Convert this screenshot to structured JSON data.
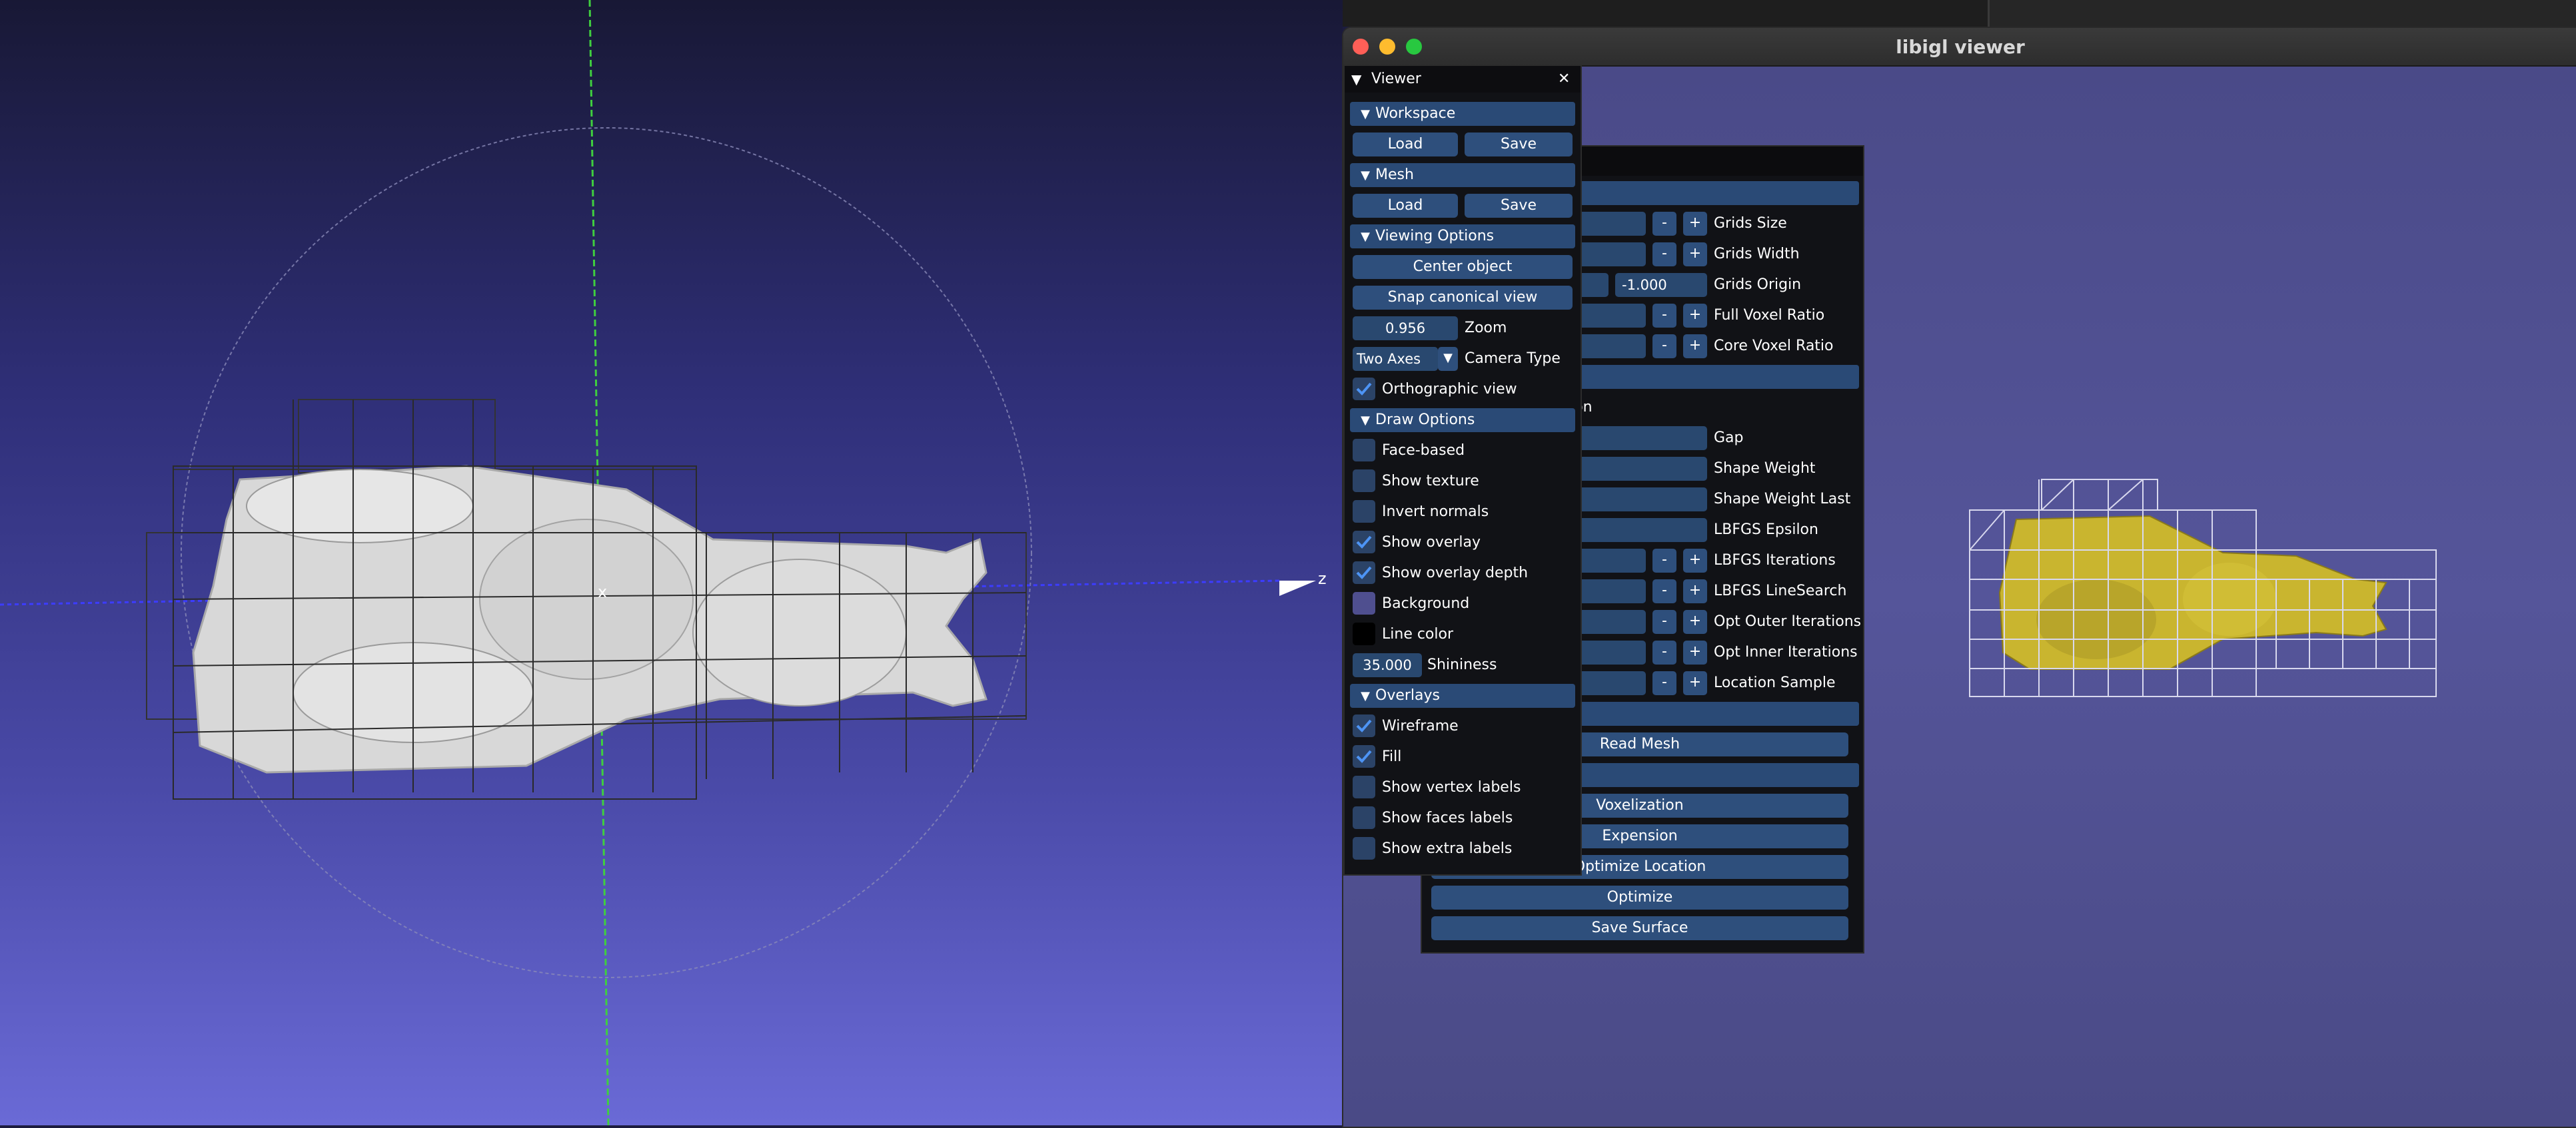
{
  "left_view": {
    "axis_x": "x",
    "axis_z": "z"
  },
  "window": {
    "title": "libigl viewer",
    "colors": {
      "close": "#ff5f57",
      "minimize": "#febc2e",
      "zoom": "#28c840"
    }
  },
  "viewer_panel": {
    "title": "Viewer",
    "close_glyph": "✕",
    "workspace": {
      "header": "Workspace",
      "load": "Load",
      "save": "Save"
    },
    "mesh": {
      "header": "Mesh",
      "load": "Load",
      "save": "Save"
    },
    "viewing_options": {
      "header": "Viewing Options",
      "center_object": "Center object",
      "snap_canonical": "Snap canonical view",
      "zoom_value": "0.956",
      "zoom_label": "Zoom",
      "camera_value": "Two Axes",
      "camera_label": "Camera Type",
      "orthographic_label": "Orthographic view",
      "orthographic_checked": true
    },
    "draw_options": {
      "header": "Draw Options",
      "items": [
        {
          "label": "Face-based",
          "checked": false
        },
        {
          "label": "Show texture",
          "checked": false
        },
        {
          "label": "Invert normals",
          "checked": false
        },
        {
          "label": "Show overlay",
          "checked": true
        },
        {
          "label": "Show overlay depth",
          "checked": true
        }
      ],
      "background_label": "Background",
      "line_color_label": "Line color",
      "shininess_value": "35.000",
      "shininess_label": "Shininess",
      "background_swatch": "#4f4f8f",
      "line_swatch": "#000000"
    },
    "overlays": {
      "header": "Overlays",
      "items": [
        {
          "label": "Wireframe",
          "checked": true
        },
        {
          "label": "Fill",
          "checked": true
        },
        {
          "label": "Show vertex labels",
          "checked": false
        },
        {
          "label": "Show faces labels",
          "checked": false
        },
        {
          "label": "Show extra labels",
          "checked": false
        }
      ]
    }
  },
  "tool_panel": {
    "grids_origin_value": "-1.000",
    "params": [
      {
        "label": "Grids Size",
        "stepper": true
      },
      {
        "label": "Grids Width",
        "stepper": true
      },
      {
        "label": "Grids Origin",
        "stepper": false
      },
      {
        "label": "Full Voxel Ratio",
        "stepper": true
      },
      {
        "label": "Core Voxel Ratio",
        "stepper": true
      }
    ],
    "partial_label": "ation",
    "params2": [
      {
        "label": "Gap",
        "stepper": false
      },
      {
        "label": "Shape Weight",
        "stepper": false
      },
      {
        "label": "Shape Weight Last",
        "stepper": false
      },
      {
        "label": "LBFGS Epsilon",
        "stepper": false
      },
      {
        "label": "LBFGS Iterations",
        "stepper": true
      },
      {
        "label": "LBFGS LineSearch",
        "stepper": true
      },
      {
        "label": "Opt Outer Iterations",
        "stepper": true
      },
      {
        "label": "Opt Inner Iterations",
        "stepper": true
      },
      {
        "label": "Location Sample",
        "stepper": true
      }
    ],
    "minus": "-",
    "plus": "+",
    "buttons": {
      "read_mesh": "Read Mesh",
      "voxelization": "Voxelization",
      "expension": "Expension",
      "optimize_location": "Optimize Location",
      "optimize": "Optimize",
      "save_surface": "Save Surface"
    }
  }
}
